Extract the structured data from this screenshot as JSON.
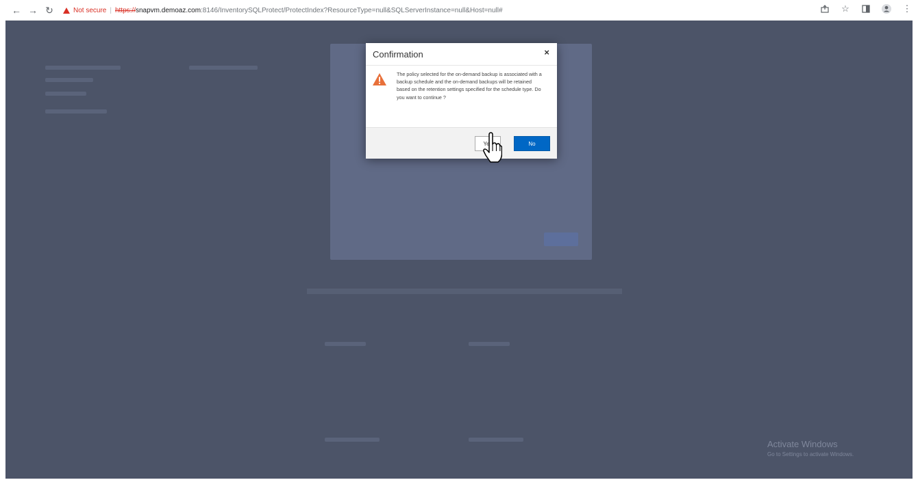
{
  "browser": {
    "security_label": "Not secure",
    "url_scheme": "https://",
    "url_host": "snapvm.demoaz.com",
    "url_path": ":8146/InventorySQLProtect/ProtectIndex?ResourceType=null&SQLServerInstance=null&Host=null#"
  },
  "dialog": {
    "title": "Confirmation",
    "close": "×",
    "message": "The policy selected for the on-demand backup is associated with a backup schedule and the on-demand backups will be retained based on the retention settings specified for the schedule type. Do you want to continue ?",
    "yes_label": "Yes",
    "no_label": "No"
  },
  "watermark": {
    "title": "Activate Windows",
    "subtitle": "Go to Settings to activate Windows."
  },
  "colors": {
    "accent": "#0067c5",
    "overlay": "#4c5468",
    "warning": "#e8703a"
  }
}
